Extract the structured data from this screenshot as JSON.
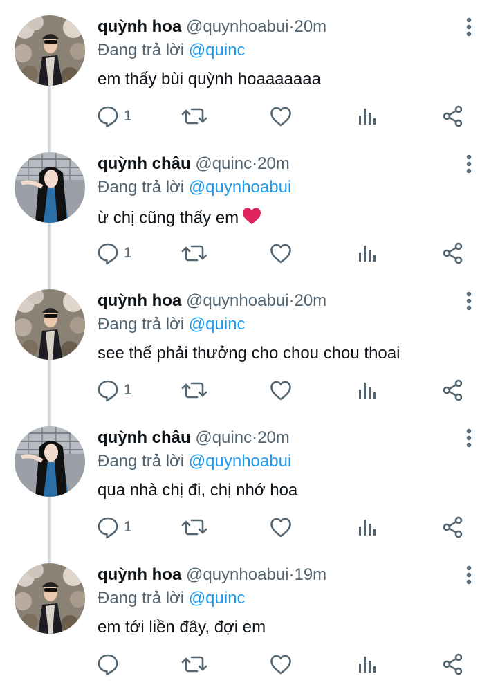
{
  "colors": {
    "accent": "#1d9bf0",
    "secondary": "#536471",
    "line": "#cfd9de"
  },
  "labels": {
    "replying_prefix": "Đang trả lời",
    "separator": "·"
  },
  "icons": {
    "reply": "reply-icon",
    "retweet": "retweet-icon",
    "like": "like-icon",
    "views": "views-icon",
    "share": "share-icon",
    "more": "more-vertical-icon",
    "emoji": "red-heart-emoji"
  },
  "tweets": [
    {
      "name": "quỳnh hoa",
      "handle": "@quynhoabui",
      "time": "20m",
      "reply_to": "@quinc",
      "text": "em thấy bùi quỳnh hoaaaaaaa",
      "reply_count": "1"
    },
    {
      "name": "quỳnh châu",
      "handle": "@quinc",
      "time": "20m",
      "reply_to": "@quynhoabui",
      "text": "ừ chị cũng thấy em",
      "reply_count": "1"
    },
    {
      "name": "quỳnh hoa",
      "handle": "@quynhoabui",
      "time": "20m",
      "reply_to": "@quinc",
      "text": "see thế phải thưởng cho chou chou thoai",
      "reply_count": "1"
    },
    {
      "name": "quỳnh châu",
      "handle": "@quinc",
      "time": "20m",
      "reply_to": "@quynhoabui",
      "text": "qua nhà chị đi, chị nhớ hoa",
      "reply_count": "1"
    },
    {
      "name": "quỳnh hoa",
      "handle": "@quynhoabui",
      "time": "19m",
      "reply_to": "@quinc",
      "text": "em tới liền đây, đợi em",
      "reply_count": ""
    }
  ]
}
